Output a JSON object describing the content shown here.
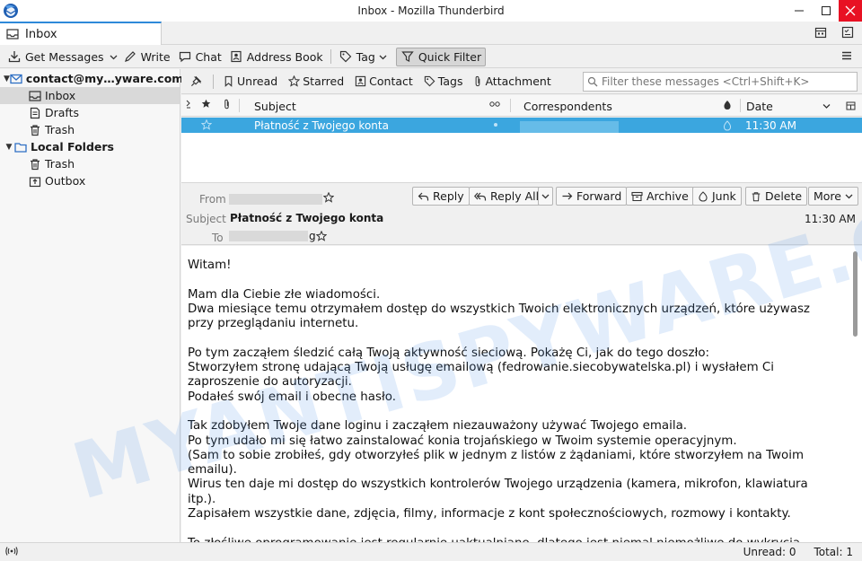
{
  "window": {
    "title": "Inbox - Mozilla Thunderbird"
  },
  "tabs": [
    {
      "label": "Inbox"
    }
  ],
  "toolbar": {
    "get_messages": "Get Messages",
    "write": "Write",
    "chat": "Chat",
    "address_book": "Address Book",
    "tag": "Tag",
    "quick_filter": "Quick Filter"
  },
  "folders": {
    "account": "contact@my…yware.com",
    "account_items": [
      "Inbox",
      "Drafts",
      "Trash"
    ],
    "local": "Local Folders",
    "local_items": [
      "Trash",
      "Outbox"
    ]
  },
  "quick_filter": {
    "unread": "Unread",
    "starred": "Starred",
    "contact": "Contact",
    "tags": "Tags",
    "attachment": "Attachment",
    "search_placeholder": "Filter these messages <Ctrl+Shift+K>"
  },
  "columns": {
    "subject": "Subject",
    "correspondents": "Correspondents",
    "date": "Date"
  },
  "messages": [
    {
      "subject": "Płatność z Twojego konta",
      "date": "11:30 AM"
    }
  ],
  "header": {
    "from_label": "From",
    "subject_label": "Subject",
    "to_label": "To",
    "subject": "Płatność z Twojego konta",
    "time": "11:30 AM",
    "to_suffix": "g",
    "buttons": {
      "reply": "Reply",
      "reply_all": "Reply All",
      "forward": "Forward",
      "archive": "Archive",
      "junk": "Junk",
      "delete": "Delete",
      "more": "More"
    }
  },
  "body": {
    "lines": [
      "Witam!",
      "",
      "Mam dla Ciebie złe wiadomości.",
      "Dwa miesiące temu otrzymałem dostęp do wszystkich Twoich elektronicznych urządzeń, które używasz",
      "przy przeglądaniu internetu.",
      "",
      "Po tym zacząłem śledzić całą Twoją aktywność sieciową. Pokażę Ci, jak do tego doszło:",
      "Stworzyłem stronę udającą Twoją usługę emailową (fedrowanie.siecobywatelska.pl) i wysłałem Ci",
      "zaproszenie do autoryzacji.",
      "Podałeś swój email i obecne hasło.",
      "",
      "Tak zdobyłem Twoje dane loginu i zacząłem niezauważony używać Twojego emaila.",
      "Po tym udało mi się łatwo zainstalować konia trojańskiego w Twoim systemie operacyjnym.",
      "(Sam to sobie zrobiłeś, gdy otworzyłeś plik w jednym z listów z żądaniami, które stworzyłem na Twoim",
      "emailu).",
      "Wirus ten daje mi dostęp do wszystkich kontrolerów Twojego urządzenia (kamera, mikrofon, klawiatura",
      "itp.).",
      "Zapisałem wszystkie dane, zdjęcia, filmy, informacje z kont społecznościowych, rozmowy i kontakty.",
      "",
      "To złośliwe oprogramowanie jest regularnie uaktualniane, dlatego jest niemal niemożliwe do wykrycia"
    ]
  },
  "status": {
    "unread": "Unread: 0",
    "total": "Total: 1"
  },
  "watermark": "MYANTISPYWARE.COM",
  "colors": {
    "selection": "#3ba6df",
    "close_button": "#e81123",
    "tab_accent": "#2e89d9"
  }
}
